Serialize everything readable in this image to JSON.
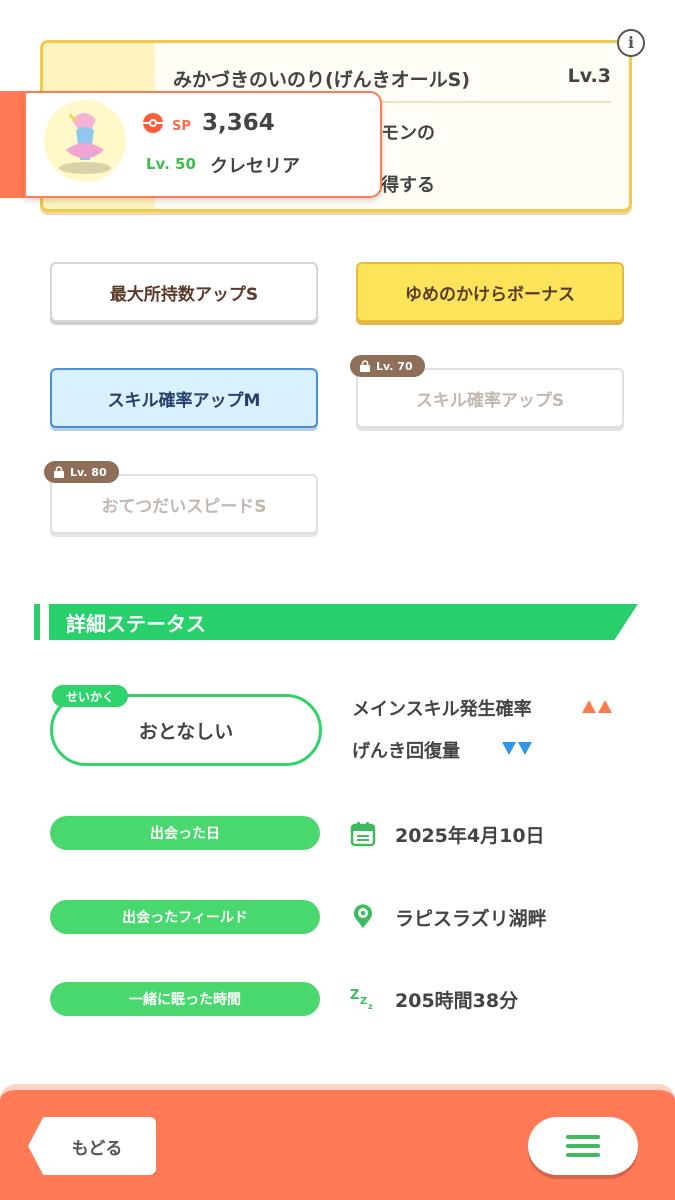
{
  "skill_card": {
    "title": "みかづきのいのり(げんきオールS)",
    "level": "Lv.3",
    "desc_line1": "イモンの",
    "desc_line2": "獲得する"
  },
  "pokemon": {
    "sp_label": "SP",
    "sp_value": "3,364",
    "level": "Lv. 50",
    "name": "クレセリア"
  },
  "sub_skills": [
    {
      "label": "最大所持数アップS",
      "style": "white",
      "locked": false,
      "lock_level": ""
    },
    {
      "label": "ゆめのかけらボーナス",
      "style": "gold",
      "locked": false,
      "lock_level": ""
    },
    {
      "label": "スキル確率アップM",
      "style": "blue",
      "locked": false,
      "lock_level": ""
    },
    {
      "label": "スキル確率アップS",
      "style": "locked",
      "locked": true,
      "lock_level": "Lv. 70"
    },
    {
      "label": "おてつだいスピードS",
      "style": "locked",
      "locked": true,
      "lock_level": "Lv. 80"
    }
  ],
  "section": {
    "title": "詳細ステータス"
  },
  "nature": {
    "tag": "せいかく",
    "value": "おとなしい",
    "up_label": "メインスキル発生確率",
    "down_label": "げんき回復量"
  },
  "info_rows": [
    {
      "label": "出会った日",
      "value": "2025年4月10日",
      "icon": "calendar-icon"
    },
    {
      "label": "出会ったフィールド",
      "value": "ラピスラズリ湖畔",
      "icon": "location-pin-icon"
    },
    {
      "label": "一緒に眠った時間",
      "value": "205時間38分",
      "icon": "sleep-zzz-icon"
    }
  ],
  "footer": {
    "back_label": "もどる",
    "menu_icon": "hamburger-menu-icon"
  },
  "colors": {
    "accent_green": "#27d06b",
    "footer_orange": "#ff7a55",
    "up_arrow": "#ff7a4a",
    "down_arrow": "#2f95e8"
  }
}
